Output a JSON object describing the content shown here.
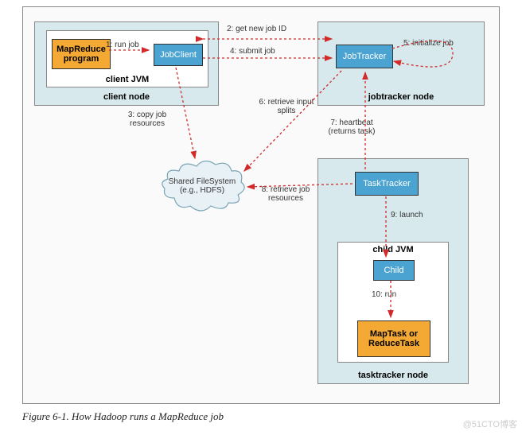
{
  "caption": "Figure 6-1. How Hadoop runs a MapReduce job",
  "watermark": "@51CTO博客",
  "nodes": {
    "client_node": {
      "label": "client node"
    },
    "jobtracker_node": {
      "label": "jobtracker node"
    },
    "tasktracker_node": {
      "label": "tasktracker node"
    },
    "client_jvm": {
      "label": "client JVM"
    },
    "child_jvm": {
      "label": "child JVM"
    }
  },
  "components": {
    "mapreduce_program": "MapReduce program",
    "jobclient": "JobClient",
    "jobtracker": "JobTracker",
    "tasktracker": "TaskTracker",
    "child": "Child",
    "maptask": "MapTask or ReduceTask",
    "filesystem": "Shared FileSystem (e.g., HDFS)"
  },
  "edges": {
    "e1": "1: run job",
    "e2": "2: get new job ID",
    "e3": "3: copy job resources",
    "e4": "4: submit job",
    "e5": "5: initialize job",
    "e6": "6: retrieve input splits",
    "e7": "7: heartbeat (returns task)",
    "e8": "8: retrieve job resources",
    "e9": "9: launch",
    "e10": "10: run"
  }
}
